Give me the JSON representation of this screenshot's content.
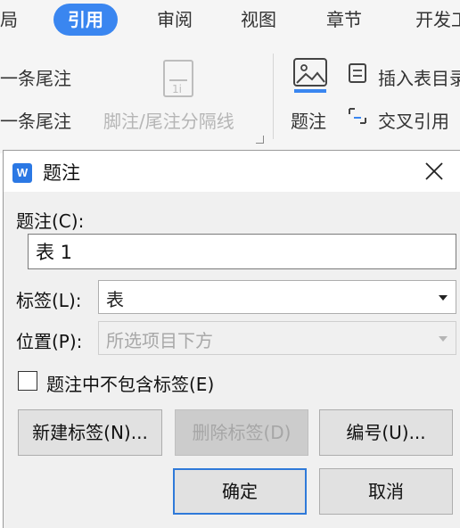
{
  "ribbon": {
    "tabs": [
      {
        "label": "布局",
        "active": false
      },
      {
        "label": "引用",
        "active": true
      },
      {
        "label": "审阅",
        "active": false
      },
      {
        "label": "视图",
        "active": false
      },
      {
        "label": "章节",
        "active": false
      },
      {
        "label": "开发工具",
        "active": false
      }
    ],
    "prev_endnote": "上一条尾注",
    "next_endnote": "下一条尾注",
    "separator_label": "脚注/尾注分隔线",
    "caption_label": "题注",
    "insert_table": "插入表目录",
    "cross_reference": "交叉引用",
    "accent_color": "#3a86f0"
  },
  "dialog": {
    "title": "题注",
    "caption_label": "题注(C):",
    "caption_value": "表 1",
    "label_label": "标签(L):",
    "label_value": "表",
    "position_label": "位置(P):",
    "position_value": "所选项目下方",
    "exclude_label_text": "题注中不包含标签(E)",
    "exclude_label_checked": false,
    "buttons": {
      "new_label": "新建标签(N)...",
      "delete_label": "删除标签(D)",
      "numbering": "编号(U)...",
      "ok": "确定",
      "cancel": "取消"
    }
  }
}
